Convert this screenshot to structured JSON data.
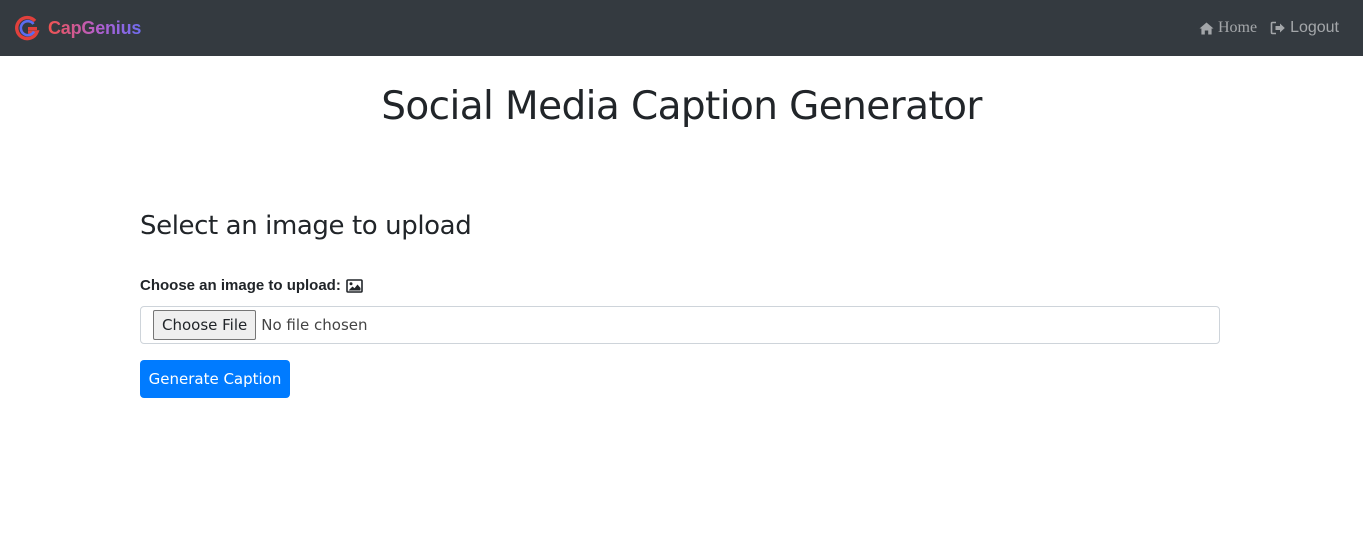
{
  "navbar": {
    "brand_name": "CapGenius",
    "brand_logo_icon": "g-logo-icon",
    "links": [
      {
        "label": "Home",
        "icon": "home-icon"
      },
      {
        "label": "Logout",
        "icon": "logout-icon"
      }
    ]
  },
  "main": {
    "title": "Social Media Caption Generator",
    "section_heading": "Select an image to upload",
    "upload_label": "Choose an image to upload:",
    "upload_label_icon": "image-icon",
    "file_input": {
      "button_label": "Choose File",
      "status_text": "No file chosen"
    },
    "submit_label": "Generate Caption"
  },
  "colors": {
    "navbar_bg": "#343a40",
    "primary": "#007bff",
    "brand_red": "#f0534f",
    "brand_purple": "#6f6cf0"
  }
}
